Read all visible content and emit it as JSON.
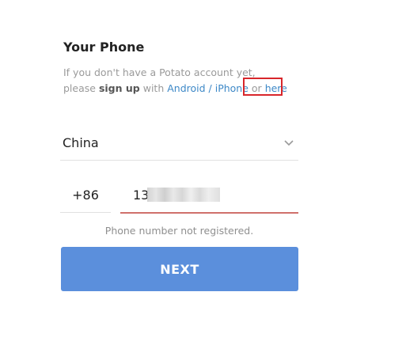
{
  "login": {
    "title": "Your Phone",
    "description": {
      "line1": "If you don't have a Potato account yet,",
      "line2_prefix": "please",
      "sign_up": "sign up",
      "with": "with",
      "android_iphone": "Android / iPhone",
      "or": "or",
      "here": "here"
    },
    "country": {
      "selected": "China"
    },
    "country_code": {
      "value": "+86"
    },
    "phone": {
      "value": "13"
    },
    "error": "Phone number not registered.",
    "next_label": "NEXT"
  },
  "colors": {
    "link": "#3d88c7",
    "highlight_box": "#d8262b",
    "error_underline": "#d0706b",
    "next_button": "#5b8fdc"
  }
}
